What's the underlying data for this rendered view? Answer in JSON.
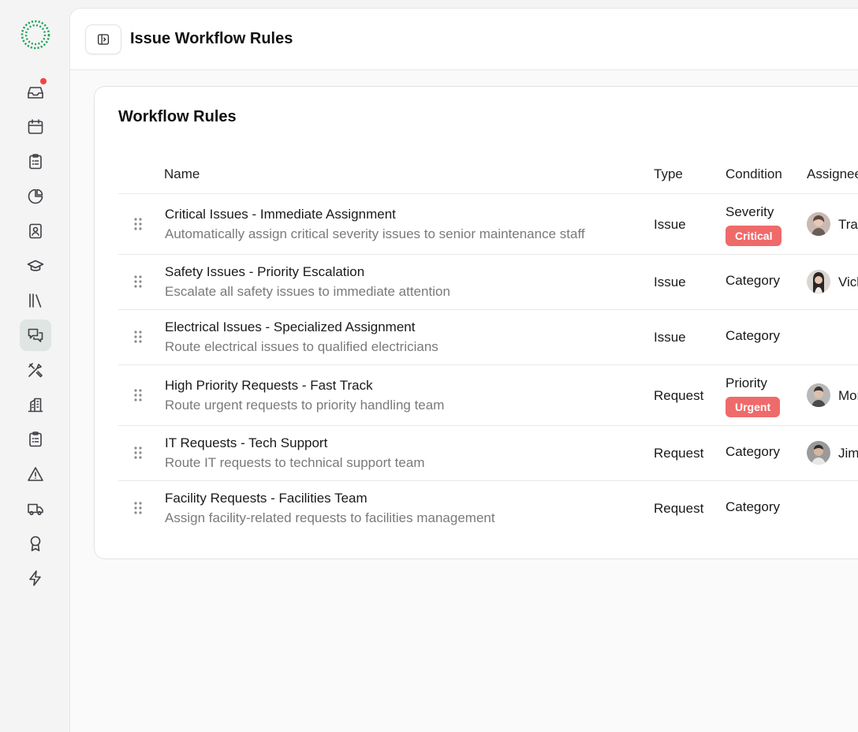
{
  "header": {
    "title": "Issue Workflow Rules"
  },
  "card": {
    "title": "Workflow Rules"
  },
  "table": {
    "columns": {
      "name": "Name",
      "type": "Type",
      "condition": "Condition",
      "assignee": "Assignee"
    },
    "rows": [
      {
        "name": "Critical Issues - Immediate Assignment",
        "description": "Automatically assign critical severity issues to senior maintenance staff",
        "type": "Issue",
        "condition": "Severity",
        "badge": "Critical",
        "assignee": "Tracy"
      },
      {
        "name": "Safety Issues - Priority Escalation",
        "description": "Escalate all safety issues to immediate attention",
        "type": "Issue",
        "condition": "Category",
        "badge": null,
        "assignee": "Vicki"
      },
      {
        "name": "Electrical Issues - Specialized Assignment",
        "description": "Route electrical issues to qualified electricians",
        "type": "Issue",
        "condition": "Category",
        "badge": null,
        "assignee": null
      },
      {
        "name": "High Priority Requests - Fast Track",
        "description": "Route urgent requests to priority handling team",
        "type": "Request",
        "condition": "Priority",
        "badge": "Urgent",
        "assignee": "Monica"
      },
      {
        "name": "IT Requests - Tech Support",
        "description": "Route IT requests to technical support team",
        "type": "Request",
        "condition": "Category",
        "badge": null,
        "assignee": "Jim"
      },
      {
        "name": "Facility Requests - Facilities Team",
        "description": "Assign facility-related requests to facilities management",
        "type": "Request",
        "condition": "Category",
        "badge": null,
        "assignee": null
      }
    ]
  },
  "sidebar": {
    "items": [
      {
        "icon": "inbox-icon",
        "has_notification": true
      },
      {
        "icon": "calendar-icon"
      },
      {
        "icon": "clipboard-icon"
      },
      {
        "icon": "pie-chart-icon"
      },
      {
        "icon": "contact-book-icon"
      },
      {
        "icon": "graduation-cap-icon"
      },
      {
        "icon": "library-icon"
      },
      {
        "icon": "messages-icon",
        "active": true
      },
      {
        "icon": "tools-icon"
      },
      {
        "icon": "building-icon"
      },
      {
        "icon": "clipboard-list-icon"
      },
      {
        "icon": "alert-triangle-icon"
      },
      {
        "icon": "truck-icon"
      },
      {
        "icon": "award-icon"
      },
      {
        "icon": "lightning-icon"
      }
    ]
  },
  "colors": {
    "accent": "#22a55a",
    "badge_red": "#ef6a6a",
    "active_nav": "#dfe5e3",
    "notification": "#ef4444"
  }
}
